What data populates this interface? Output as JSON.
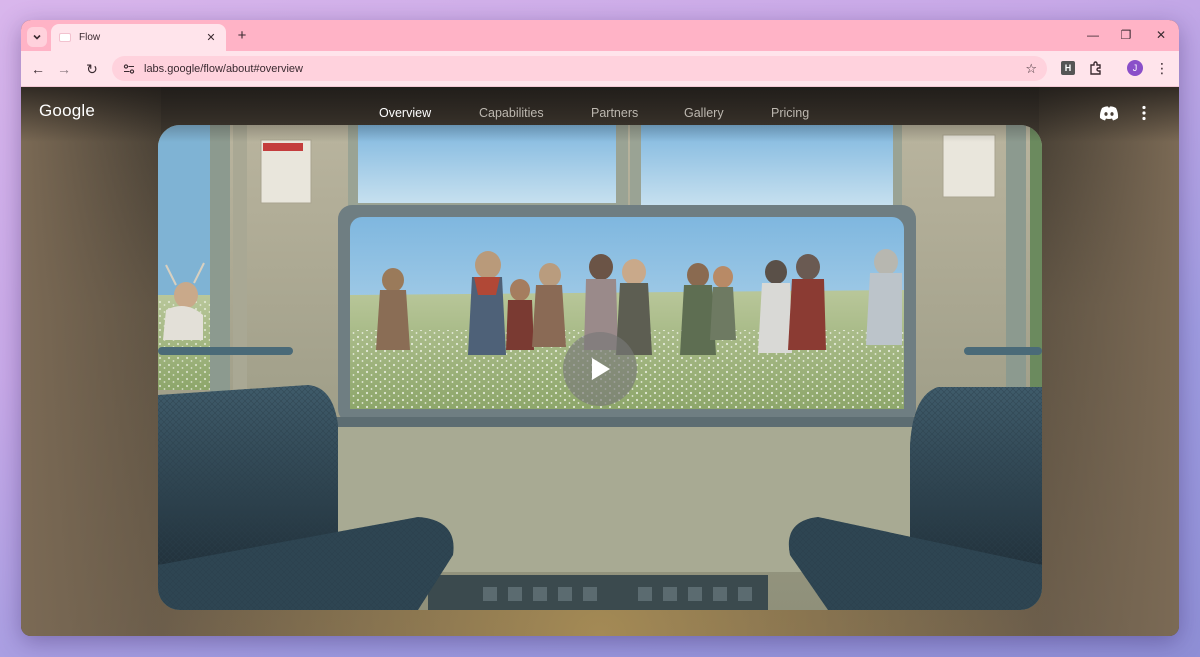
{
  "browser": {
    "tab": {
      "title": "Flow",
      "close_glyph": "✕"
    },
    "new_tab_glyph": "+",
    "window_controls": {
      "minimize": "—",
      "restore": "❐",
      "close": "✕"
    },
    "toolbar": {
      "back_glyph": "←",
      "forward_glyph": "→",
      "reload_glyph": "↻",
      "url": "labs.google/flow/about#overview",
      "bookmark_glyph": "☆",
      "extension_letter": "H",
      "profile_initial": "J",
      "menu_glyph": "⋮"
    }
  },
  "site": {
    "logo": "Google",
    "nav": [
      {
        "label": "Overview",
        "active": true
      },
      {
        "label": "Capabilities",
        "active": false
      },
      {
        "label": "Partners",
        "active": false
      },
      {
        "label": "Gallery",
        "active": false
      },
      {
        "label": "Pricing",
        "active": false
      }
    ],
    "icons": [
      "discord-icon",
      "more-vert-icon",
      "play-icon"
    ],
    "video": {
      "state": "paused"
    }
  },
  "colors": {
    "tabstrip": "#ffb3c6",
    "toolbar": "#ffe4eb",
    "omnibox": "#ffd2dd",
    "avatar": "#8a4fc9",
    "nav_active": "#ffffff",
    "nav_inactive": "#bdb8b0"
  }
}
